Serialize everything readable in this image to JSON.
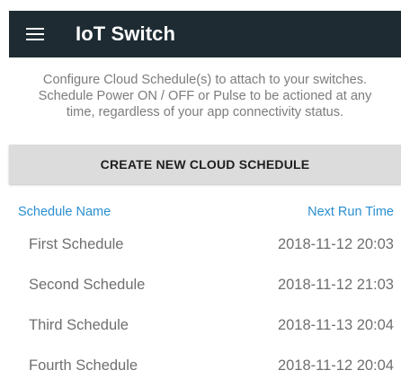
{
  "app_bar": {
    "title": "IoT Switch",
    "menu_icon": "hamburger-menu-icon",
    "background_color": "#1e2b33"
  },
  "intro": {
    "line1": "Configure Cloud Schedule(s) to attach to your switches.",
    "line2": "Schedule Power ON / OFF or Pulse to be actioned at any",
    "line3": "time, regardless of your app connectivity status."
  },
  "create_button": {
    "label": "CREATE NEW CLOUD SCHEDULE"
  },
  "schedules": {
    "header": {
      "name": "Schedule Name",
      "next_run": "Next Run Time"
    },
    "rows": [
      {
        "name": "First Schedule",
        "next_run": "2018-11-12 20:03"
      },
      {
        "name": "Second Schedule",
        "next_run": "2018-11-12 21:03"
      },
      {
        "name": "Third Schedule",
        "next_run": "2018-11-13 20:04"
      },
      {
        "name": "Fourth Schedule",
        "next_run": "2018-11-12 20:04"
      }
    ]
  },
  "colors": {
    "accent": "#2a8fd0",
    "button_background": "#dcdcdc",
    "text_muted": "#7c7c7c"
  }
}
